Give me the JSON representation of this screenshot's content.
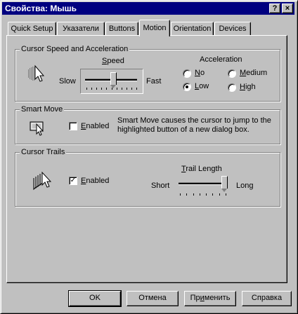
{
  "window": {
    "title": "Свойства: Мышь",
    "help_button": "?",
    "close_button": "×"
  },
  "tabs": [
    {
      "label": "Quick Setup"
    },
    {
      "label": "Указатели"
    },
    {
      "label": "Buttons"
    },
    {
      "label": "Motion"
    },
    {
      "label": "Orientation"
    },
    {
      "label": "Devices"
    }
  ],
  "active_tab": "Motion",
  "speed_group": {
    "legend": "Cursor Speed and Acceleration",
    "speed_label_pre": "",
    "speed_label_ul": "S",
    "speed_label_post": "peed",
    "slow": "Slow",
    "fast": "Fast",
    "speed_value": 0.55,
    "acceleration_label": "Acceleration",
    "options": [
      {
        "pre": "",
        "ul": "N",
        "post": "o",
        "selected": false
      },
      {
        "pre": "",
        "ul": "M",
        "post": "edium",
        "selected": false
      },
      {
        "pre": "",
        "ul": "L",
        "post": "ow",
        "selected": true
      },
      {
        "pre": "",
        "ul": "H",
        "post": "igh",
        "selected": false
      }
    ]
  },
  "smart_move": {
    "legend": "Smart Move",
    "checkbox_pre": "",
    "checkbox_ul": "E",
    "checkbox_post": "nabled",
    "checked": false,
    "description_line1": "Smart Move causes the cursor to jump to the",
    "description_line2": "highlighted button of a new dialog box."
  },
  "cursor_trails": {
    "legend": "Cursor Trails",
    "checkbox_pre": "",
    "checkbox_ul": "E",
    "checkbox_post": "nabled",
    "checked": true,
    "check_mark": "✓",
    "trail_pre": "",
    "trail_ul": "T",
    "trail_post": "rail Length",
    "short": "Short",
    "long": "Long",
    "trail_value": 1.0
  },
  "buttons": {
    "ok": "OK",
    "cancel": "Отмена",
    "apply_pre": "Пр",
    "apply_ul": "и",
    "apply_post": "менить",
    "help": "Справка"
  }
}
